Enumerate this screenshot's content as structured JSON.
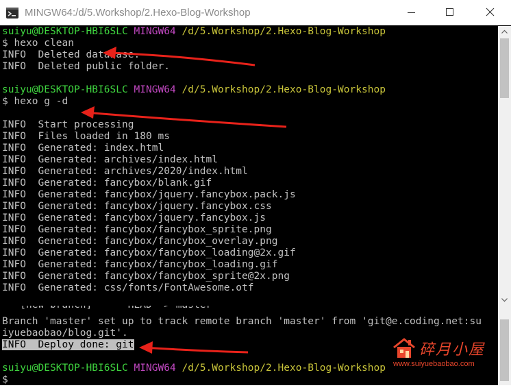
{
  "window": {
    "title": "MINGW64:/d/5.Workshop/2.Hexo-Blog-Workshop"
  },
  "prompt": {
    "user": "suiyu@DESKTOP-HBI6SLC",
    "shell": "MINGW64",
    "path": "/d/5.Workshop/2.Hexo-Blog-Workshop"
  },
  "terminal_top": {
    "cmd1": "$ hexo clean",
    "cmd1_output": [
      "INFO  Deleted database.",
      "INFO  Deleted public folder."
    ],
    "cmd2": "$ hexo g -d",
    "cmd2_output": [
      "INFO  Start processing",
      "INFO  Files loaded in 180 ms",
      "INFO  Generated: index.html",
      "INFO  Generated: archives/index.html",
      "INFO  Generated: archives/2020/index.html",
      "INFO  Generated: fancybox/blank.gif",
      "INFO  Generated: fancybox/jquery.fancybox.pack.js",
      "INFO  Generated: fancybox/jquery.fancybox.css",
      "INFO  Generated: fancybox/jquery.fancybox.js",
      "INFO  Generated: fancybox/fancybox_sprite.png",
      "INFO  Generated: fancybox/fancybox_overlay.png",
      "INFO  Generated: fancybox/fancybox_loading@2x.gif",
      "INFO  Generated: fancybox/fancybox_loading.gif",
      "INFO  Generated: fancybox/fancybox_sprite@2x.png",
      "INFO  Generated: css/fonts/FontAwesome.otf"
    ]
  },
  "terminal_bottom": {
    "partial_line": "   [new branch]      HEAD -> master",
    "lines": [
      "Branch 'master' set up to track remote branch 'master' from 'git@e.coding.net:su",
      "iyuebaobao/blog.git'."
    ],
    "deploy_done": "INFO  Deploy done: git",
    "final_prompt": "$"
  },
  "watermark": {
    "title": "碎月小屋",
    "url": "www.suiyuebaobao.com"
  },
  "colors": {
    "prompt_user": "#3fd43f",
    "prompt_shell": "#c148c1",
    "prompt_path": "#c8c43a",
    "arrow": "#e8221a",
    "watermark": "#e8462c"
  }
}
